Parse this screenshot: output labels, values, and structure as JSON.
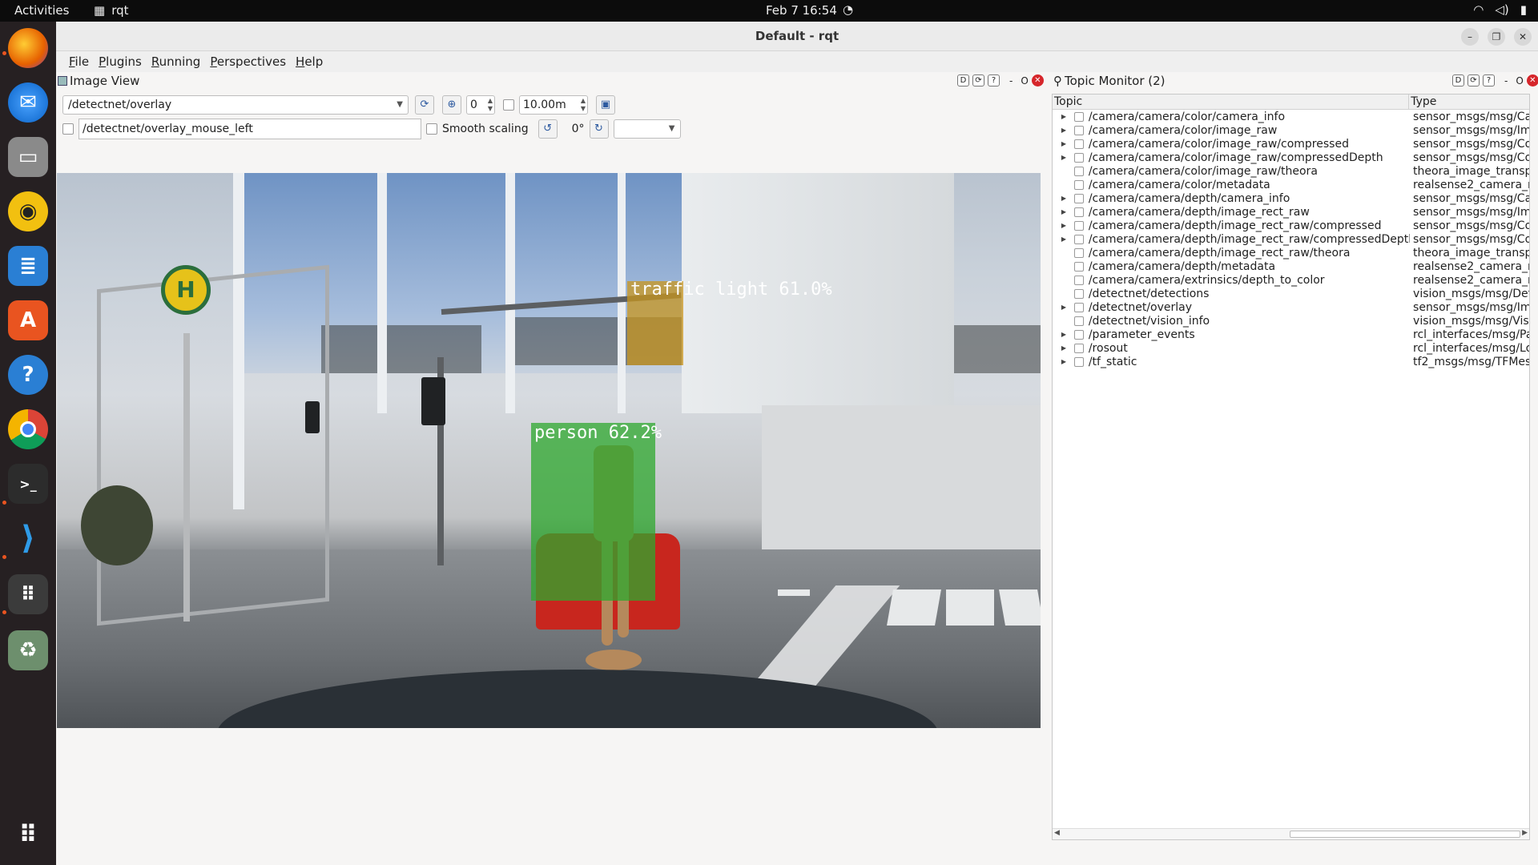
{
  "topbar": {
    "activities": "Activities",
    "app": "rqt",
    "clock": "Feb 7  16:54"
  },
  "dock": {
    "items": [
      "firefox-icon",
      "thunderbird-icon",
      "files-icon",
      "rhythmbox-icon",
      "writer-icon",
      "software-icon",
      "help-icon",
      "chrome-icon",
      "terminal-icon",
      "vscode-icon",
      "app-grid-icon",
      "trash-icon",
      "show-apps-icon"
    ]
  },
  "window": {
    "title": "Default - rqt"
  },
  "menu": [
    "File",
    "Plugins",
    "Running",
    "Perspectives",
    "Help"
  ],
  "image_view": {
    "title": "Image View",
    "topic": "/detectnet/overlay",
    "zoom_value": "0",
    "duration": "10.00m",
    "mouse_topic": "/detectnet/overlay_mouse_left",
    "smooth_label": "Smooth scaling",
    "rotation": "0°",
    "detections": [
      {
        "label": "traffic light 61.0%",
        "color": "#c8961e"
      },
      {
        "label": "person 62.2%",
        "color": "#2ea82e"
      }
    ]
  },
  "topic_monitor": {
    "title": "Topic Monitor (2)",
    "col_topic": "Topic",
    "col_type": "Type",
    "rows": [
      {
        "topic": "/camera/camera/color/camera_info",
        "type": "sensor_msgs/msg/Ca",
        "expandable": true
      },
      {
        "topic": "/camera/camera/color/image_raw",
        "type": "sensor_msgs/msg/Im",
        "expandable": true
      },
      {
        "topic": "/camera/camera/color/image_raw/compressed",
        "type": "sensor_msgs/msg/Co",
        "expandable": true
      },
      {
        "topic": "/camera/camera/color/image_raw/compressedDepth",
        "type": "sensor_msgs/msg/Co",
        "expandable": true
      },
      {
        "topic": "/camera/camera/color/image_raw/theora",
        "type": "theora_image_transp",
        "expandable": false
      },
      {
        "topic": "/camera/camera/color/metadata",
        "type": "realsense2_camera_m",
        "expandable": false
      },
      {
        "topic": "/camera/camera/depth/camera_info",
        "type": "sensor_msgs/msg/Ca",
        "expandable": true
      },
      {
        "topic": "/camera/camera/depth/image_rect_raw",
        "type": "sensor_msgs/msg/Im",
        "expandable": true
      },
      {
        "topic": "/camera/camera/depth/image_rect_raw/compressed",
        "type": "sensor_msgs/msg/Co",
        "expandable": true
      },
      {
        "topic": "/camera/camera/depth/image_rect_raw/compressedDepth",
        "type": "sensor_msgs/msg/Co",
        "expandable": true
      },
      {
        "topic": "/camera/camera/depth/image_rect_raw/theora",
        "type": "theora_image_transp",
        "expandable": false
      },
      {
        "topic": "/camera/camera/depth/metadata",
        "type": "realsense2_camera_m",
        "expandable": false
      },
      {
        "topic": "/camera/camera/extrinsics/depth_to_color",
        "type": "realsense2_camera_m",
        "expandable": false
      },
      {
        "topic": "/detectnet/detections",
        "type": "vision_msgs/msg/Det",
        "expandable": false
      },
      {
        "topic": "/detectnet/overlay",
        "type": "sensor_msgs/msg/Im",
        "expandable": true
      },
      {
        "topic": "/detectnet/vision_info",
        "type": "vision_msgs/msg/Visi",
        "expandable": false
      },
      {
        "topic": "/parameter_events",
        "type": "rcl_interfaces/msg/Pa",
        "expandable": true
      },
      {
        "topic": "/rosout",
        "type": "rcl_interfaces/msg/Lo",
        "expandable": true
      },
      {
        "topic": "/tf_static",
        "type": "tf2_msgs/msg/TFMes",
        "expandable": true
      }
    ]
  }
}
